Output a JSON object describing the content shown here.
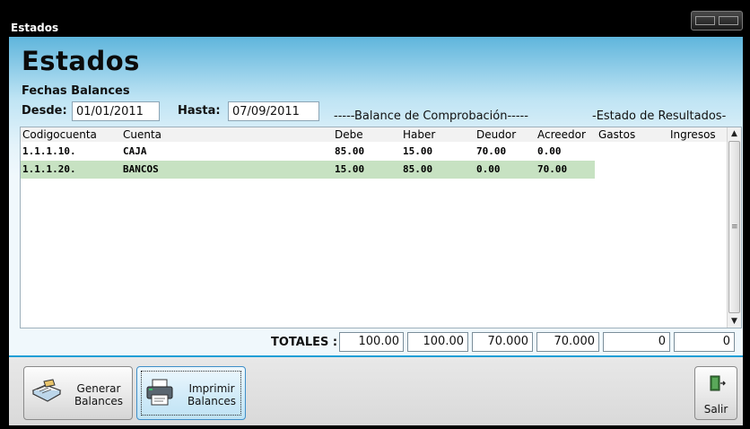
{
  "window": {
    "title": "Estados"
  },
  "form": {
    "heading": "Estados",
    "fechas_label": "Fechas Balances",
    "desde_label": "Desde:",
    "desde_value": "01/01/2011",
    "hasta_label": "Hasta:",
    "hasta_value": "07/09/2011",
    "balance_caption": "-----Balance de Comprobación-----",
    "resultados_caption": "-Estado de Resultados-"
  },
  "grid": {
    "columns": [
      "Codigocuenta",
      "Cuenta",
      "Debe",
      "Haber",
      "Deudor",
      "Acreedor",
      "Gastos",
      "Ingresos"
    ],
    "rows": [
      {
        "codigo": "1.1.1.10.",
        "cuenta": "CAJA",
        "debe": "85.00",
        "haber": "15.00",
        "deudor": "70.00",
        "acreedor": "0.00",
        "gastos": "",
        "ingresos": ""
      },
      {
        "codigo": "1.1.1.20.",
        "cuenta": "BANCOS",
        "debe": "15.00",
        "haber": "85.00",
        "deudor": "0.00",
        "acreedor": "70.00",
        "gastos": "",
        "ingresos": ""
      }
    ]
  },
  "totals": {
    "label": "TOTALES :",
    "debe": "100.00",
    "haber": "100.00",
    "deudor": "70.000",
    "acreedor": "70.000",
    "gastos": "0",
    "ingresos": "0"
  },
  "buttons": {
    "generar_line1": "Generar",
    "generar_line2": "Balances",
    "imprimir_line1": "Imprimir",
    "imprimir_line2": "Balances",
    "salir": "Salir"
  },
  "icons": {
    "generar": "book-icon",
    "imprimir": "printer-icon",
    "salir": "exit-door-icon"
  },
  "colors": {
    "selected_row": "#c7e2c2",
    "footer_accent": "#1f9fd6"
  }
}
